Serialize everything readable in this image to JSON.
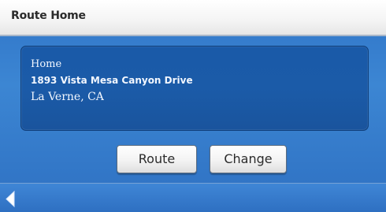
{
  "title_bar": {
    "title": "Route Home"
  },
  "address": {
    "name": "Home",
    "street": "1893 Vista Mesa Canyon Drive",
    "city": "La Verne, CA"
  },
  "actions": {
    "route_label": "Route",
    "change_label": "Change"
  },
  "navigation": {
    "back_icon": "back-arrow-icon"
  },
  "colors": {
    "screen_blue": "#3b82d0",
    "panel_blue": "#1b5ba8",
    "button_face": "#f2f2f2"
  }
}
